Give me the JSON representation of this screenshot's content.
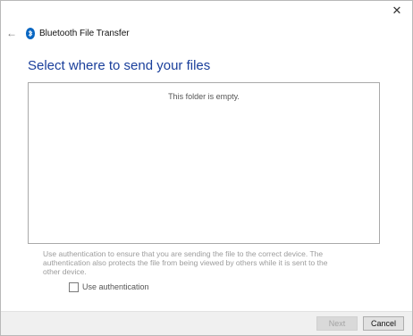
{
  "window": {
    "title": "Bluetooth File Transfer",
    "close_glyph": "✕",
    "back_glyph": "←",
    "icons": {
      "app": "bluetooth-icon",
      "back": "back-arrow-icon",
      "close": "close-icon"
    },
    "colors": {
      "heading": "#1a3f9b",
      "bluetooth": "#0a67c2",
      "footer_bg": "#f0f0f0"
    }
  },
  "main": {
    "heading": "Select where to send your files",
    "file_list": {
      "empty_text": "This folder is empty."
    },
    "auth_description": "Use authentication to ensure that you are sending the file to the correct device. The authentication also protects the file from being viewed by others while it is sent to the other device.",
    "auth_checkbox": {
      "label": "Use authentication",
      "checked": false
    }
  },
  "footer": {
    "next_label": "Next",
    "next_enabled": false,
    "cancel_label": "Cancel"
  }
}
